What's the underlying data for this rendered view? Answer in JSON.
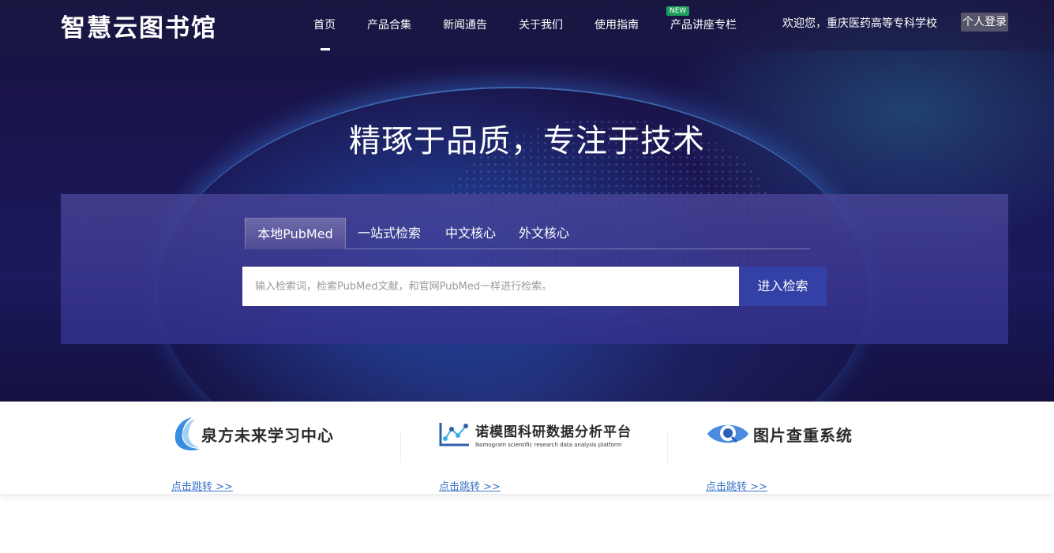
{
  "header": {
    "logo": "智慧云图书馆",
    "nav": [
      "首页",
      "产品合集",
      "新闻通告",
      "关于我们",
      "使用指南",
      "产品讲座专栏"
    ],
    "new_badge": "NEW",
    "welcome": "欢迎您，重庆医药高等专科学校",
    "login": "个人登录"
  },
  "hero": {
    "slogan": "精琢于品质，专注于技术"
  },
  "search": {
    "tabs": [
      "本地PubMed",
      "一站式检索",
      "中文核心",
      "外文核心"
    ],
    "active_tab": "本地PubMed",
    "placeholder": "输入检索词，检索PubMed文献，和官网PubMed一样进行检索。",
    "button": "进入检索"
  },
  "links": [
    {
      "title": "泉方未来学习中心",
      "subtitle": "",
      "link": "点击跳转 >>",
      "icon": "crescent-logo-icon"
    },
    {
      "title": "诺模图科研数据分析平台",
      "subtitle": "Nomogram scientific research data analysis platform",
      "link": "点击跳转 >>",
      "icon": "nomogram-chart-icon"
    },
    {
      "title": "图片查重系统",
      "subtitle": "",
      "link": "点击跳转 >>",
      "icon": "eye-magnifier-icon"
    }
  ],
  "colors": {
    "hero_bg": "#1b1550",
    "search_button": "#3340a6",
    "link_blue": "#3a73c6",
    "badge_green": "#1f9e5c"
  }
}
